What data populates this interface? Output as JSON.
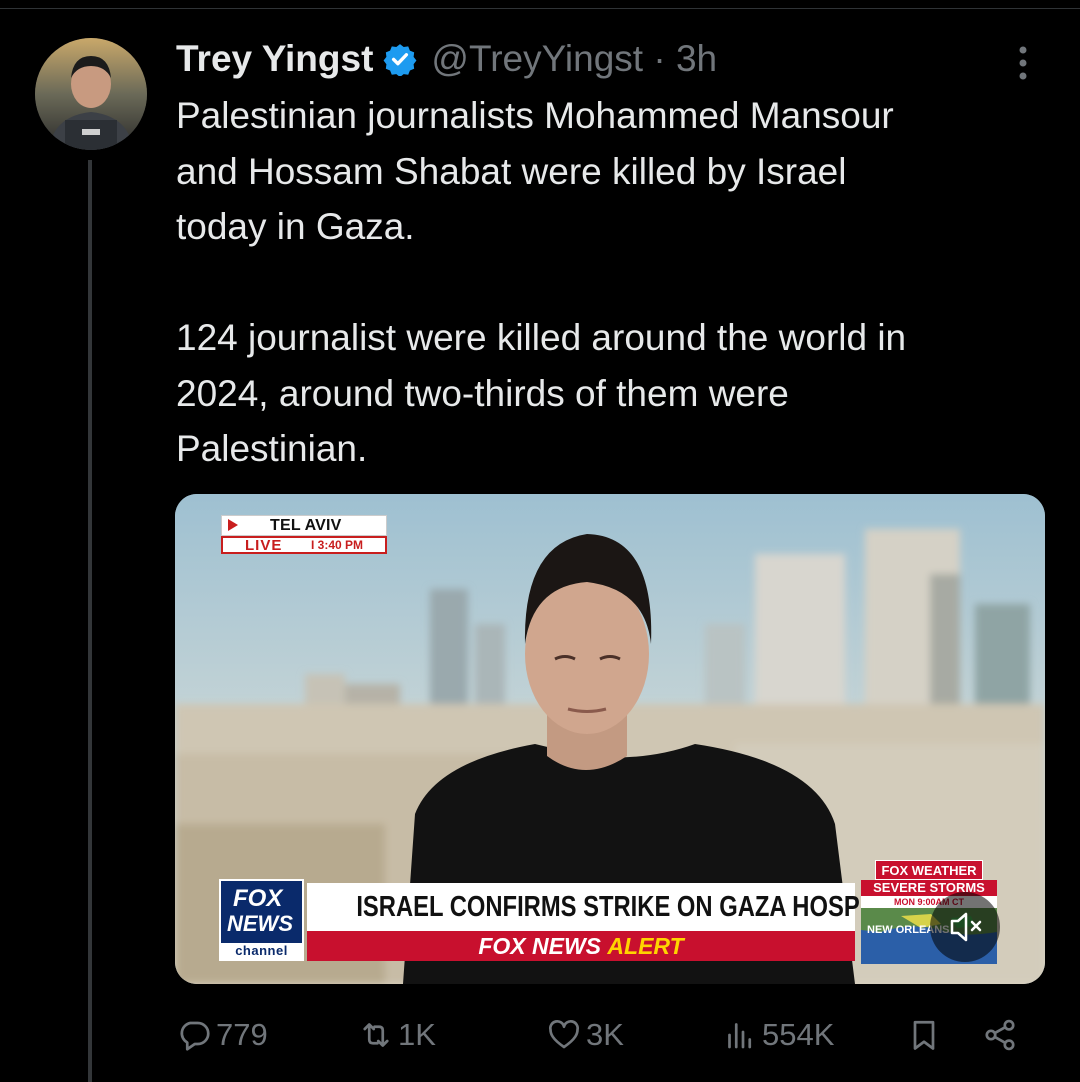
{
  "tweet": {
    "author_name": "Trey Yingst",
    "handle_time": "@TreyYingst · 3h",
    "text": "Palestinian journalists Mohammed Mansour\nand Hossam Shabat were killed by Israel\ntoday in Gaza.\n\n124 journalist were killed around the world in\n2024, around two-thirds of them were\nPalestinian."
  },
  "media": {
    "location": "TEL AVIV",
    "live_label": "LIVE",
    "live_time": "I  3:40 PM",
    "logo_line1": "FOX",
    "logo_line2": "NEWS",
    "logo_line3": "channel",
    "headline": "ISRAEL CONFIRMS STRIKE ON GAZA HOSPITAL",
    "alert_part1": "FOX NEWS ",
    "alert_part2": "ALERT",
    "weather_brand": "FOX WEATHER",
    "weather_title": "SEVERE STORMS",
    "weather_time": "MON 9:00AM CT",
    "weather_city": "NEW ORLEANS"
  },
  "actions": {
    "replies": "779",
    "reposts": "1K",
    "likes": "3K",
    "views": "554K"
  },
  "colors": {
    "background": "#000000",
    "secondary_text": "#71767b",
    "verified_blue": "#1d9bf0",
    "fox_red": "#c8102e",
    "fox_navy": "#0a2a6b"
  },
  "icons": [
    "verified-badge-icon",
    "more-options-icon",
    "reply-icon",
    "repost-icon",
    "like-icon",
    "views-icon",
    "bookmark-icon",
    "share-icon",
    "mute-icon"
  ]
}
